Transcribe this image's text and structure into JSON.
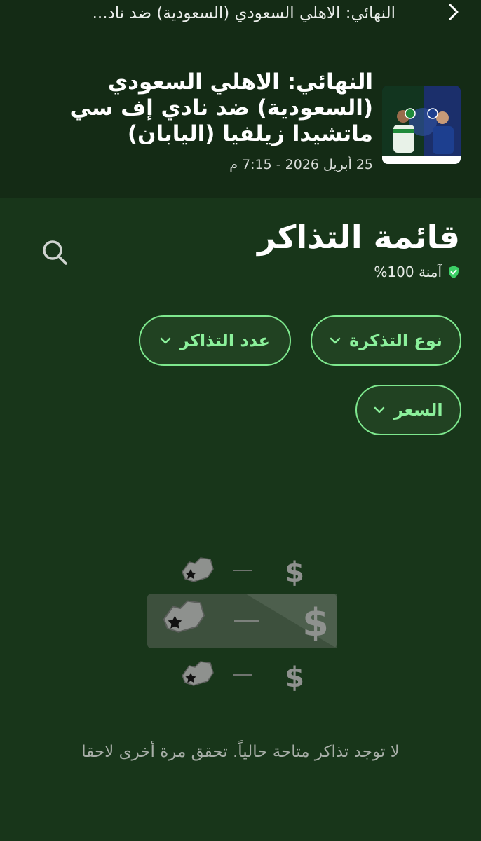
{
  "topbar": {
    "title": "النهائي: الاهلي السعودي (السعودية) ضد ناد...",
    "back_icon": "chevron-right-icon"
  },
  "event": {
    "title": "النهائي: الاهلي السعودي (السعودية) ضد نادي إف سي ماتشيدا زيلفيا (اليابان)",
    "date": "25 أبريل 2026 - 7:15 م"
  },
  "main": {
    "title": "قائمة التذاكر",
    "secure_text": "آمنة 100%",
    "search_icon": "search-icon",
    "filters": {
      "ticket_type": "نوع التذكرة",
      "ticket_count": "عدد التذاكر",
      "price": "السعر"
    },
    "empty_message": "لا توجد تذاكر متاحة حالياً. تحقق مرة أخرى لاحقا",
    "illustration_rows": [
      {
        "symbol": "$"
      },
      {
        "symbol": "$"
      },
      {
        "symbol": "$"
      }
    ]
  },
  "colors": {
    "header_bg": "#142b15",
    "main_bg": "#18361a",
    "accent": "#8bf09b",
    "secure_badge": "#3ccf66"
  }
}
